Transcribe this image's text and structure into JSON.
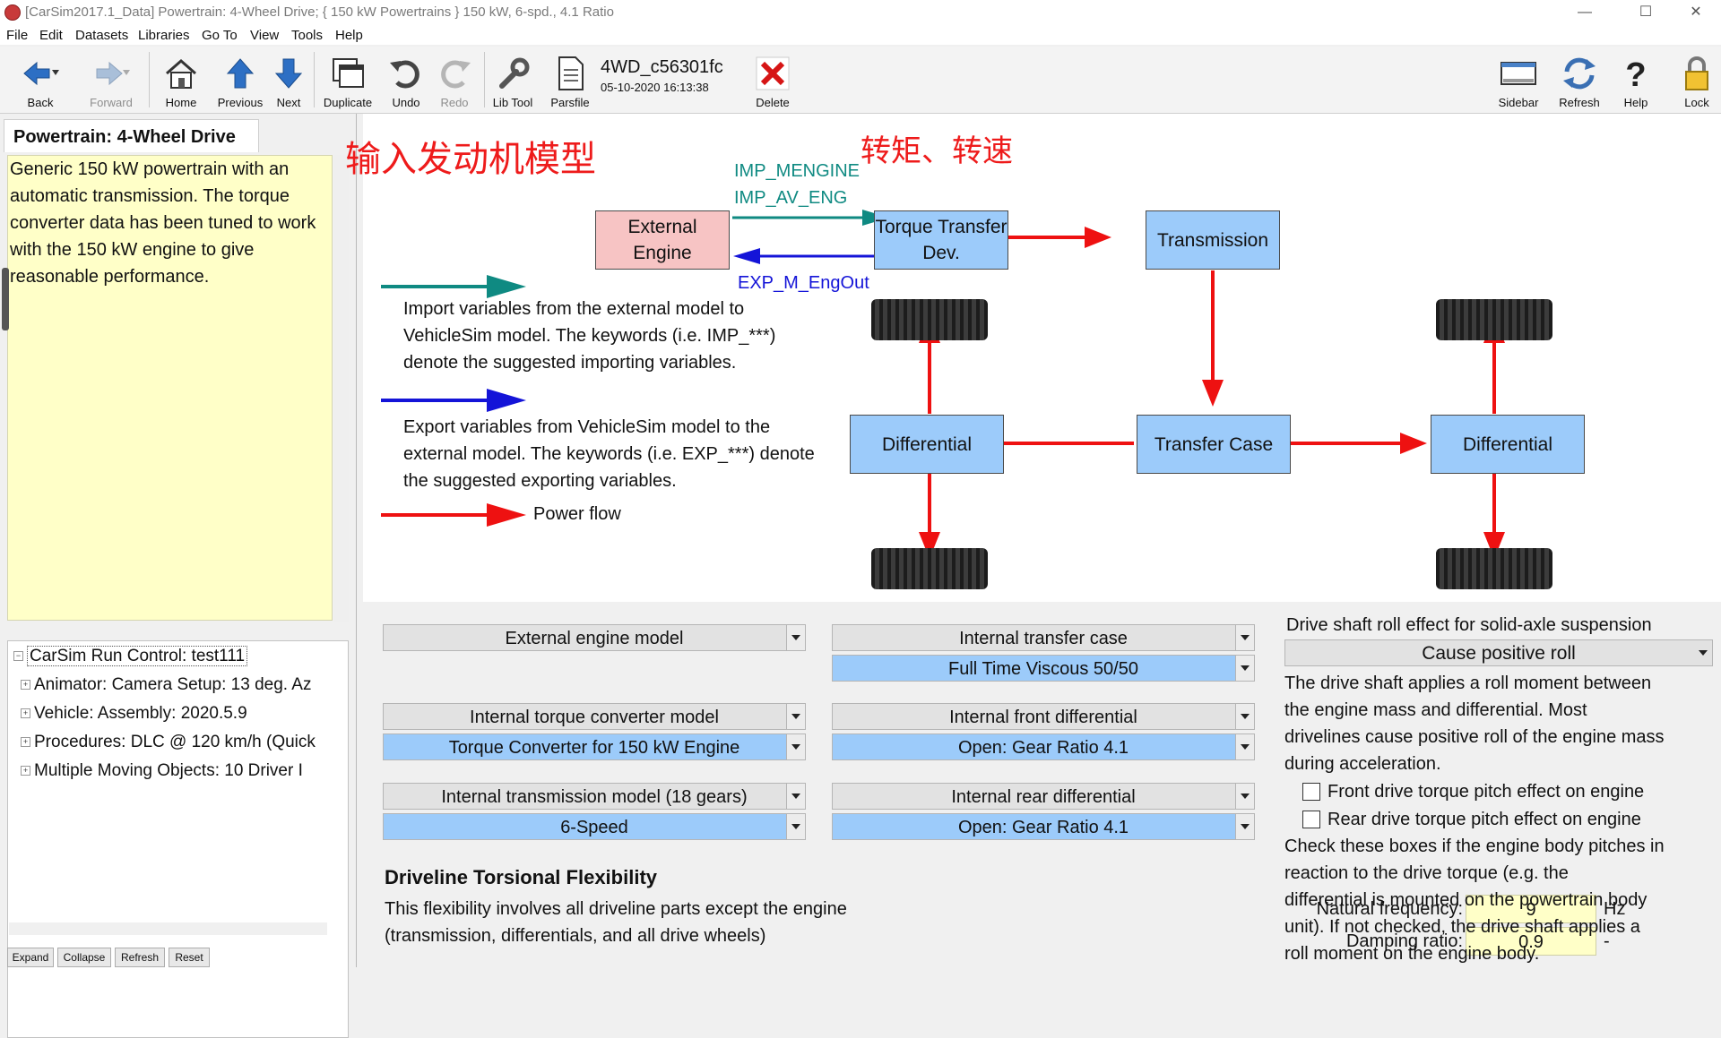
{
  "window": {
    "title": "[CarSim2017.1_Data] Powertrain: 4-Wheel Drive; { 150 kW Powertrains } 150 kW, 6-spd., 4.1 Ratio",
    "controls": [
      "—",
      "☐",
      "✕"
    ]
  },
  "menu": [
    "File",
    "Edit",
    "Datasets",
    "Libraries",
    "Go To",
    "View",
    "Tools",
    "Help"
  ],
  "toolbar": {
    "back": "Back",
    "forward": "Forward",
    "home": "Home",
    "previous": "Previous",
    "next": "Next",
    "duplicate": "Duplicate",
    "undo": "Undo",
    "redo": "Redo",
    "libtool": "Lib Tool",
    "parsfile": "Parsfile",
    "dataset_name": "4WD_c56301fc",
    "dataset_date": "05-10-2020 16:13:38",
    "delete": "Delete",
    "sidebar": "Sidebar",
    "refresh": "Refresh",
    "help": "Help",
    "lock": "Lock"
  },
  "left": {
    "tab_title": "Powertrain: 4-Wheel Drive",
    "notes": "Generic 150 kW powertrain with an automatic transmission. The torque converter data has been tuned to work with the 150 kW engine to give reasonable performance.",
    "tree": {
      "root": "CarSim Run Control: test111",
      "items": [
        "Animator: Camera Setup: 13 deg. Az",
        "Vehicle: Assembly: 2020.5.9",
        "Procedures: DLC @ 120 km/h (Quick",
        "Multiple Moving Objects: 10 Driver I"
      ]
    },
    "buttons": [
      "Expand",
      "Collapse",
      "Refresh",
      "Reset"
    ]
  },
  "diagram": {
    "annotation_engine": "输入发动机模型",
    "annotation_torque": "转矩、转速",
    "kw_import1": "IMP_MENGINE",
    "kw_import2": "IMP_AV_ENG",
    "kw_export": "EXP_M_EngOut",
    "external_engine": "External Engine",
    "torque_transfer": "Torque Transfer Dev.",
    "transmission": "Transmission",
    "transfer_case": "Transfer Case",
    "differential_front": "Differential",
    "differential_rear": "Differential",
    "legend_import": "Import variables from the external model to VehicleSim model. The keywords (i.e. IMP_***) denote the suggested importing variables.",
    "legend_export": "Export variables from VehicleSim model to the external model. The keywords (i.e. EXP_***) denote the suggested exporting variables.",
    "legend_power": "Power flow",
    "colors": {
      "import": "#0f8a82",
      "export": "#1414d8",
      "power": "#ee1111",
      "box": "#9ccbfa",
      "engine_box": "#f7c4c4"
    }
  },
  "lower": {
    "engine_model": "External engine model",
    "transfer_case_label": "Internal transfer case",
    "transfer_case_value": "Full Time Viscous 50/50",
    "torque_conv_label": "Internal torque converter model",
    "torque_conv_value": "Torque Converter for 150 kW Engine",
    "front_diff_label": "Internal front differential",
    "front_diff_value": "Open: Gear Ratio 4.1",
    "trans_label": "Internal transmission model (18 gears)",
    "trans_value": "6-Speed",
    "rear_diff_label": "Internal rear differential",
    "rear_diff_value": "Open: Gear Ratio 4.1",
    "torsional_title": "Driveline Torsional Flexibility",
    "torsional_desc_1": "This flexibility involves all driveline parts except the engine",
    "torsional_desc_2": "(transmission, differentials, and all drive wheels)",
    "nat_freq_label": "Natural frequency:",
    "nat_freq_value": "9",
    "nat_freq_unit": "Hz",
    "damping_label": "Damping ratio:",
    "damping_value": "0.9",
    "damping_unit": "-",
    "roll_title": "Drive shaft roll effect for solid-axle suspension",
    "roll_value": "Cause positive roll",
    "roll_desc": [
      "The drive shaft applies a roll moment between",
      "the engine mass and differential. Most",
      "drivelines cause positive roll of the engine mass",
      "during acceleration."
    ],
    "front_pitch_label": "Front drive torque pitch effect on engine",
    "rear_pitch_label": "Rear drive torque pitch effect on engine",
    "pitch_desc": [
      "Check these boxes if the engine body pitches in",
      "reaction to the drive torque (e.g. the",
      "differential is mounted on the powertrain body",
      "unit). If not checked, the drive shaft applies a",
      "roll moment on the engine body."
    ]
  }
}
